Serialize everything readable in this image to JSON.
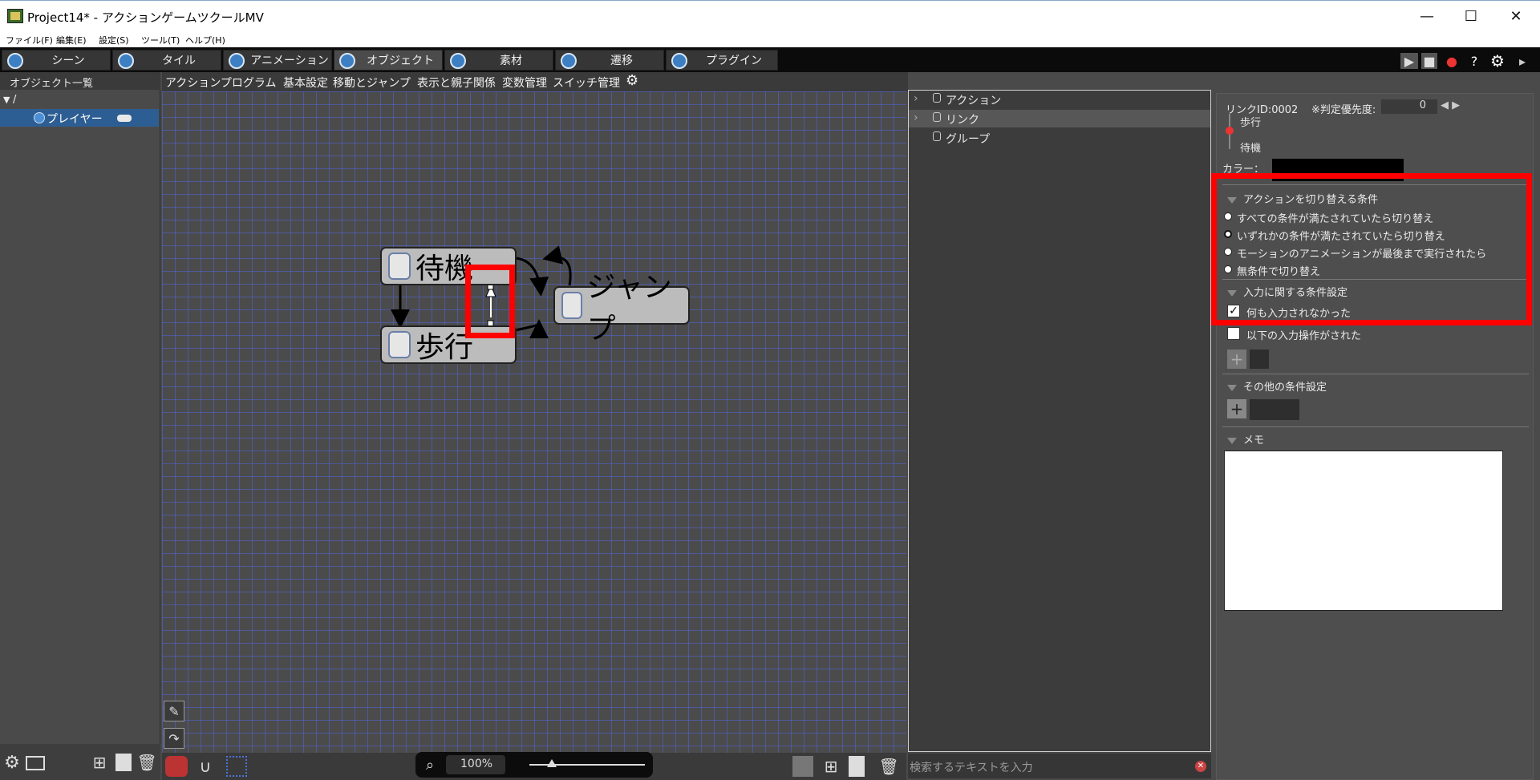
{
  "window": {
    "title": "Project14* - アクションゲームツクールMV",
    "minimize": "—",
    "maximize": "☐",
    "close": "✕"
  },
  "menu": [
    "ファイル(F)",
    "編集(E)",
    "設定(S)",
    "ツール(T)",
    "ヘルプ(H)"
  ],
  "tabs": [
    "シーン",
    "タイル",
    "アニメーション",
    "オブジェクト",
    "素材",
    "遷移",
    "プラグイン"
  ],
  "active_tab": "オブジェクト",
  "left_panel": {
    "header": "オブジェクト一覧",
    "root": "/",
    "selected": "プレイヤー"
  },
  "subtabs": [
    "アクションプログラム",
    "基本設定",
    "移動とジャンプ",
    "表示と親子関係",
    "変数管理",
    "スイッチ管理"
  ],
  "nodes": {
    "idle": "待機",
    "walk": "歩行",
    "jump": "ジャンプ"
  },
  "zoom": "100%",
  "list": {
    "items": [
      "アクション",
      "リンク",
      "グループ"
    ],
    "search_placeholder": "検索するテキストを入力"
  },
  "right": {
    "link_id": "リンクID:0002",
    "priority_label": "※判定優先度:",
    "priority_value": "0",
    "from": "歩行",
    "to": "待機",
    "color_label": "カラー：",
    "sec_switch": "アクションを切り替える条件",
    "radios": [
      "すべての条件が満たされていたら切り替え",
      "いずれかの条件が満たされていたら切り替え",
      "モーションのアニメーションが最後まで実行されたら",
      "無条件で切り替え"
    ],
    "sec_input": "入力に関する条件設定",
    "chk_none": "何も入力されなかった",
    "chk_ops": "以下の入力操作がされた",
    "sec_other": "その他の条件設定",
    "sec_memo": "メモ"
  },
  "colors": {
    "highlight": "#ff0000",
    "selection": "#2d5e93"
  }
}
